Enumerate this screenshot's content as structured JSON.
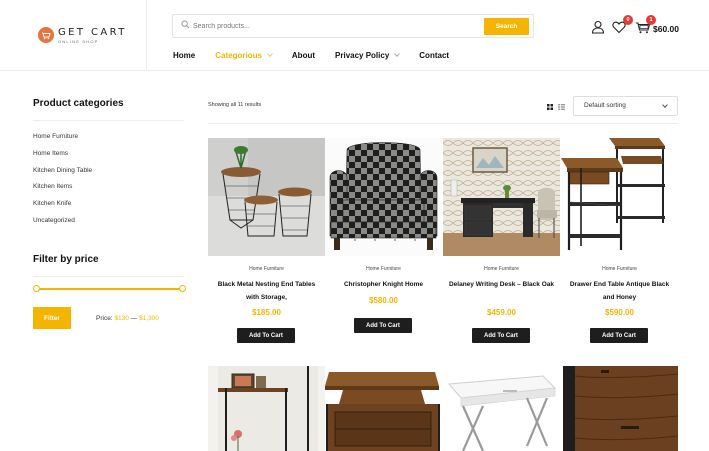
{
  "logo": {
    "name": "GET CART",
    "tagline": "ONLINE SHOP"
  },
  "search": {
    "placeholder": "Search products...",
    "button_label": "Search"
  },
  "nav": {
    "items": [
      {
        "label": "Home"
      },
      {
        "label": "Categorious"
      },
      {
        "label": "About"
      },
      {
        "label": "Privacy Policy"
      },
      {
        "label": "Contact"
      }
    ]
  },
  "header": {
    "wishlist_count": "0",
    "cart_count": "1",
    "cart_total": "$60.00"
  },
  "sidebar": {
    "categories_title": "Product categories",
    "categories": [
      "Home Furniture",
      "Home Items",
      "Kitchen Dining Table",
      "Kitchen Items",
      "Kitchen Knife",
      "Uncategorized"
    ],
    "price_title": "Filter by price",
    "filter_label": "Filter",
    "price_prefix": "Price:",
    "price_min": "$130",
    "price_sep": "—",
    "price_max": "$1,300",
    "slider_min_fraction": 0,
    "slider_max_fraction": 1
  },
  "shop": {
    "results_text": "Showing all 11 results",
    "sort_value": "Default sorting",
    "add_to_cart_label": "Add To Cart"
  },
  "products": [
    {
      "category": "Home Furniture",
      "title": "Black Metal Nesting End Tables with Storage,",
      "price": "$185.00"
    },
    {
      "category": "Home Furniture",
      "title": "Christopher Knight Home",
      "price": "$580.00"
    },
    {
      "category": "Home Furniture",
      "title": "Delaney Writing Desk – Black Oak",
      "price": "$459.00"
    },
    {
      "category": "Home Furniture",
      "title": "Drawer End Table Antique Black and Honey",
      "price": "$590.00"
    }
  ],
  "colors": {
    "accent": "#f5b400",
    "dark_button": "#1e1e1e",
    "badge": "#e53935",
    "logo": "#e9733d"
  },
  "icons": [
    "search-icon",
    "user-icon",
    "heart-icon",
    "cart-icon",
    "grid-view-icon",
    "list-view-icon"
  ]
}
